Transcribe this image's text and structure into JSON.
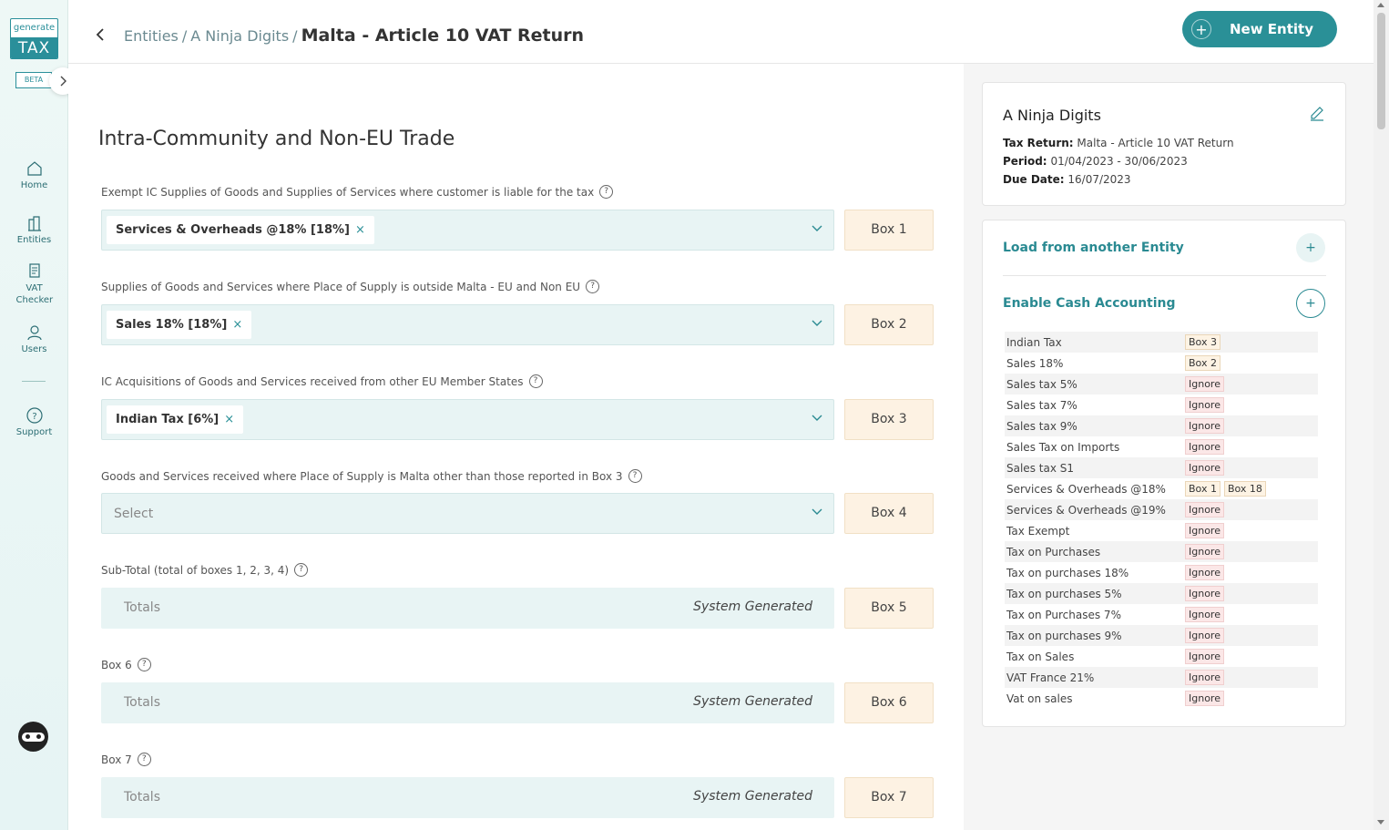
{
  "logo": {
    "top": "generate",
    "bottom": "TAX"
  },
  "beta_label": "BETA",
  "nav": [
    {
      "label": "Home"
    },
    {
      "label": "Entities"
    },
    {
      "label": "VAT Checker"
    },
    {
      "label": "Users"
    },
    {
      "label": "Support"
    }
  ],
  "header": {
    "crumb_1": "Entities",
    "crumb_2": "A Ninja Digits",
    "separator": "/",
    "current": "Malta - Article 10 VAT Return",
    "new_entity_label": "New Entity",
    "new_entity_plus": "+"
  },
  "form": {
    "section_title": "Intra-Community and Non-EU Trade",
    "help_glyph": "?",
    "chevron_icon": "chevron-down-icon",
    "remove_glyph": "×",
    "fields": [
      {
        "label": "Exempt IC Supplies of Goods and Supplies of Services where customer is liable for the tax",
        "chip": "Services & Overheads @18% [18%]",
        "box": "Box 1"
      },
      {
        "label": "Supplies of Goods and Services where Place of Supply is outside Malta - EU and Non EU",
        "chip": "Sales 18% [18%]",
        "box": "Box 2"
      },
      {
        "label": "IC Acquisitions of Goods and Services received from other EU Member States",
        "chip": "Indian Tax [6%]",
        "box": "Box 3"
      },
      {
        "label": "Goods and Services received where Place of Supply is Malta other than those reported in Box 3",
        "placeholder": "Select",
        "box": "Box 4"
      },
      {
        "label": "Sub-Total (total of boxes 1, 2, 3, 4)",
        "totals": "Totals",
        "generated": "System Generated",
        "box": "Box 5"
      },
      {
        "label": "Box 6",
        "totals": "Totals",
        "generated": "System Generated",
        "box": "Box 6"
      },
      {
        "label": "Box 7",
        "totals": "Totals",
        "generated": "System Generated",
        "box": "Box 7"
      }
    ]
  },
  "entity_card": {
    "name": "A Ninja Digits",
    "tax_return_label": "Tax Return:",
    "tax_return": "Malta - Article 10 VAT Return",
    "period_label": "Period:",
    "period": "01/04/2023 - 30/06/2023",
    "due_label": "Due Date:",
    "due": "16/07/2023"
  },
  "accordion": {
    "load_label": "Load from another Entity",
    "cash_label": "Enable Cash Accounting",
    "plus": "+"
  },
  "mapping": [
    {
      "name": "Indian Tax",
      "tags": [
        "Box 3"
      ]
    },
    {
      "name": "Sales 18%",
      "tags": [
        "Box 2"
      ]
    },
    {
      "name": "Sales tax 5%",
      "tags": [
        "Ignore"
      ]
    },
    {
      "name": "Sales tax 7%",
      "tags": [
        "Ignore"
      ]
    },
    {
      "name": "Sales tax 9%",
      "tags": [
        "Ignore"
      ]
    },
    {
      "name": "Sales Tax on Imports",
      "tags": [
        "Ignore"
      ]
    },
    {
      "name": "Sales tax S1",
      "tags": [
        "Ignore"
      ]
    },
    {
      "name": "Services & Overheads @18%",
      "tags": [
        "Box 1",
        "Box 18"
      ]
    },
    {
      "name": "Services & Overheads @19%",
      "tags": [
        "Ignore"
      ]
    },
    {
      "name": "Tax Exempt",
      "tags": [
        "Ignore"
      ]
    },
    {
      "name": "Tax on Purchases",
      "tags": [
        "Ignore"
      ]
    },
    {
      "name": "Tax on purchases 18%",
      "tags": [
        "Ignore"
      ]
    },
    {
      "name": "Tax on purchases 5%",
      "tags": [
        "Ignore"
      ]
    },
    {
      "name": "Tax on Purchases 7%",
      "tags": [
        "Ignore"
      ]
    },
    {
      "name": "Tax on purchases 9%",
      "tags": [
        "Ignore"
      ]
    },
    {
      "name": "Tax on Sales",
      "tags": [
        "Ignore"
      ]
    },
    {
      "name": "VAT France 21%",
      "tags": [
        "Ignore"
      ]
    },
    {
      "name": "Vat on sales",
      "tags": [
        "Ignore"
      ]
    }
  ]
}
